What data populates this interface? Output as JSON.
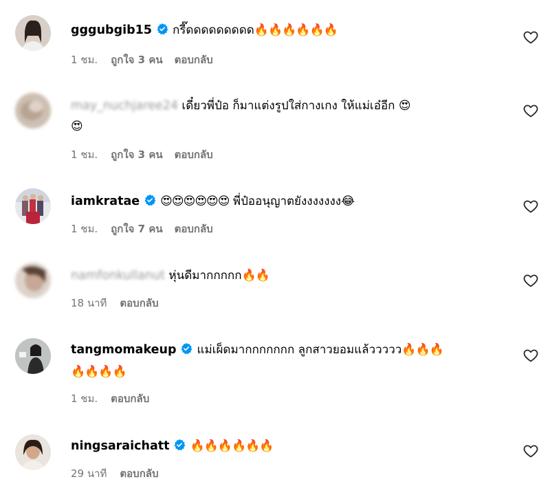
{
  "comments": [
    {
      "username": "gggubgib15",
      "verified": true,
      "blurred": false,
      "text": "กรี๊ดดดดดดดดด",
      "emoji": "🔥🔥🔥🔥🔥🔥",
      "emoji2": "",
      "time": "1 ชม.",
      "likes": "ถูกใจ 3 คน",
      "reply": "ตอบกลับ"
    },
    {
      "username": "may_nuchjaree24",
      "verified": false,
      "blurred": true,
      "text": "เดี๋ยวพี่ป๋อ ก็มาแต่งรูปใส่กางเกง ให้แม่เอ๋อีก",
      "emoji": "😍",
      "emoji2": "😍",
      "time": "1 ชม.",
      "likes": "ถูกใจ 3 คน",
      "reply": "ตอบกลับ"
    },
    {
      "username": "iamkratae",
      "verified": true,
      "blurred": false,
      "text": "พี่ป๋ออนุญาตยังงงงงงง",
      "emoji": "😍😍😍😍😍😍",
      "emoji_after": "😂",
      "time": "1 ชม.",
      "likes": "ถูกใจ 7 คน",
      "reply": "ตอบกลับ"
    },
    {
      "username": "namfonkullanut",
      "verified": false,
      "blurred": true,
      "text": "หุ่นดีมากกกกก",
      "emoji": "🔥🔥",
      "time": "18 นาที",
      "reply": "ตอบกลับ"
    },
    {
      "username": "tangmomakeup",
      "verified": true,
      "blurred": false,
      "text": "แม่เผ็ดมากกกกกกก ลูกสาวยอมแล้ววววว",
      "emoji": "🔥🔥🔥",
      "emoji2": "🔥🔥🔥🔥",
      "time": "1 ชม.",
      "reply": "ตอบกลับ"
    },
    {
      "username": "ningsaraichatt",
      "verified": true,
      "blurred": false,
      "text": "",
      "emoji": "🔥🔥🔥🔥🔥🔥",
      "time": "29 นาที",
      "reply": "ตอบกลับ"
    }
  ],
  "colors": {
    "verified": "#0095f6",
    "meta": "#737373",
    "text": "#000000"
  },
  "icons": {
    "like": "heart-outline-icon",
    "verified": "verified-badge-icon"
  }
}
